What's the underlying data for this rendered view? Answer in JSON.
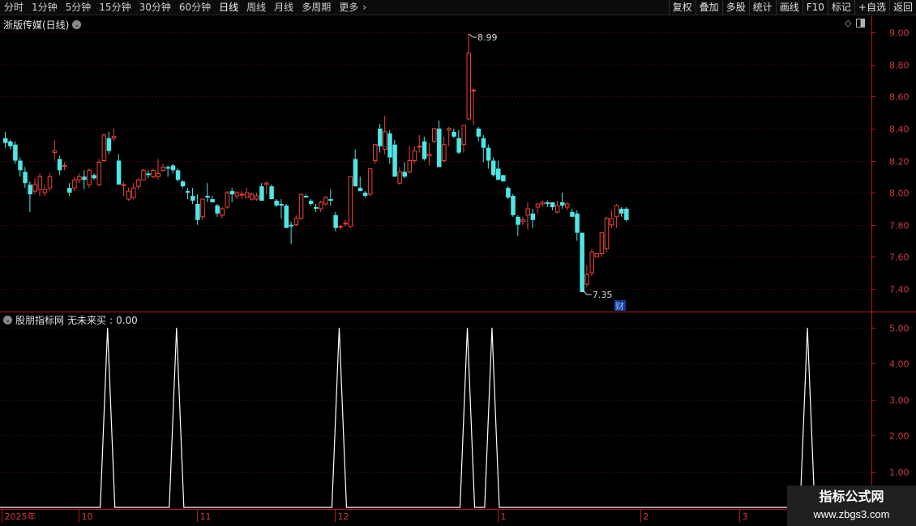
{
  "toolbar": {
    "periods": [
      "分时",
      "1分钟",
      "5分钟",
      "15分钟",
      "30分钟",
      "60分钟",
      "日线",
      "周线",
      "月线",
      "多周期",
      "更多"
    ],
    "active_period": "日线",
    "more_arrow": "›",
    "right_buttons": [
      "复权",
      "叠加",
      "多股",
      "统计",
      "画线",
      "F10",
      "标记",
      "+自选",
      "返回"
    ]
  },
  "price_panel": {
    "title": "浙版传媒(日线)",
    "high_label": "8.99",
    "low_label": "7.35",
    "cai_badge": "财"
  },
  "indicator_panel": {
    "source": "股朋指标网",
    "name": "无未来买",
    "value": "0.00"
  },
  "x_axis": {
    "labels": [
      {
        "text": "2025年",
        "bar": 0
      },
      {
        "text": "10",
        "bar": 16
      },
      {
        "text": "11",
        "bar": 40
      },
      {
        "text": "12",
        "bar": 68
      },
      {
        "text": "1",
        "bar": 101
      },
      {
        "text": "2",
        "bar": 130
      },
      {
        "text": "3",
        "bar": 150
      }
    ]
  },
  "colors": {
    "up": "#f0443a",
    "down": "#4fe6e6",
    "frame": "#b21a1a",
    "axis_text": "#d23c3c",
    "line": "#ffffff"
  },
  "watermark": {
    "line1": "指标公式网",
    "line2": "www.zbgs3.com"
  },
  "chart_data": [
    {
      "type": "candlestick",
      "series_name": "浙版传媒(日线)",
      "ylim": [
        7.3,
        9.05
      ],
      "yticks": [
        7.4,
        7.6,
        7.8,
        8.0,
        8.2,
        8.4,
        8.6,
        8.8,
        9.0
      ],
      "ohlc": [
        [
          8.34,
          8.38,
          8.28,
          8.31
        ],
        [
          8.32,
          8.33,
          8.27,
          8.29
        ],
        [
          8.3,
          8.32,
          8.18,
          8.2
        ],
        [
          8.2,
          8.22,
          8.1,
          8.14
        ],
        [
          8.13,
          8.16,
          8.03,
          8.06
        ],
        [
          8.05,
          8.07,
          7.88,
          7.99
        ],
        [
          8.01,
          8.09,
          7.99,
          8.05
        ],
        [
          8.02,
          8.12,
          7.98,
          8.1
        ],
        [
          8.0,
          8.05,
          7.98,
          8.02
        ],
        [
          8.03,
          8.12,
          8.01,
          8.1
        ],
        [
          8.25,
          8.33,
          8.2,
          8.26
        ],
        [
          8.21,
          8.23,
          8.11,
          8.14
        ],
        [
          8.17,
          8.19,
          8.14,
          8.17
        ],
        [
          8.03,
          8.06,
          7.98,
          8.0
        ],
        [
          8.03,
          8.1,
          8.01,
          8.08
        ],
        [
          8.08,
          8.12,
          8.06,
          8.1
        ],
        [
          8.1,
          8.14,
          8.02,
          8.08
        ],
        [
          8.05,
          8.15,
          8.03,
          8.14
        ],
        [
          8.11,
          8.12,
          8.08,
          8.09
        ],
        [
          8.05,
          8.21,
          8.04,
          8.19
        ],
        [
          8.2,
          8.37,
          8.19,
          8.36
        ],
        [
          8.34,
          8.38,
          8.24,
          8.26
        ],
        [
          8.34,
          8.4,
          8.32,
          8.35
        ],
        [
          8.2,
          8.24,
          8.07,
          8.05
        ],
        [
          8.05,
          8.07,
          7.98,
          8.05
        ],
        [
          7.96,
          8.03,
          7.95,
          8.01
        ],
        [
          7.97,
          8.06,
          7.96,
          8.03
        ],
        [
          8.04,
          8.09,
          8.02,
          8.08
        ],
        [
          8.08,
          8.15,
          8.08,
          8.14
        ],
        [
          8.12,
          8.14,
          8.09,
          8.11
        ],
        [
          8.1,
          8.15,
          8.09,
          8.14
        ],
        [
          8.1,
          8.21,
          8.08,
          8.12
        ],
        [
          8.14,
          8.18,
          8.13,
          8.16
        ],
        [
          8.16,
          8.17,
          8.1,
          8.15
        ],
        [
          8.17,
          8.18,
          8.12,
          8.14
        ],
        [
          8.14,
          8.15,
          8.07,
          8.08
        ],
        [
          8.07,
          8.08,
          8.03,
          8.04
        ],
        [
          8.01,
          8.03,
          7.96,
          8.0
        ],
        [
          7.98,
          8.03,
          7.93,
          7.95
        ],
        [
          7.93,
          7.99,
          7.8,
          7.83
        ],
        [
          7.85,
          7.96,
          7.83,
          7.96
        ],
        [
          7.98,
          8.06,
          7.94,
          7.97
        ],
        [
          7.96,
          7.98,
          7.94,
          7.94
        ],
        [
          7.92,
          7.93,
          7.85,
          7.87
        ],
        [
          7.86,
          7.91,
          7.84,
          7.9
        ],
        [
          7.91,
          8.01,
          7.9,
          8.0
        ],
        [
          8.01,
          8.03,
          7.94,
          7.99
        ],
        [
          7.98,
          8.01,
          7.96,
          8.0
        ],
        [
          7.99,
          8.01,
          7.96,
          7.99
        ],
        [
          7.97,
          8.03,
          7.97,
          8.0
        ],
        [
          7.96,
          8.0,
          7.95,
          7.99
        ],
        [
          7.96,
          8.0,
          7.95,
          7.98
        ],
        [
          8.04,
          8.06,
          7.95,
          7.95
        ],
        [
          8.05,
          8.07,
          7.99,
          8.06
        ],
        [
          8.04,
          8.05,
          7.96,
          7.96
        ],
        [
          7.95,
          7.96,
          7.91,
          7.92
        ],
        [
          7.93,
          7.96,
          7.84,
          7.92
        ],
        [
          7.92,
          7.93,
          7.79,
          7.78
        ],
        [
          7.8,
          7.82,
          7.68,
          7.79
        ],
        [
          7.8,
          7.86,
          7.79,
          7.84
        ],
        [
          7.84,
          7.99,
          7.83,
          7.99
        ],
        [
          7.98,
          7.99,
          7.97,
          7.97
        ],
        [
          7.95,
          7.96,
          7.92,
          7.93
        ],
        [
          7.91,
          7.93,
          7.88,
          7.9
        ],
        [
          7.9,
          7.95,
          7.88,
          7.94
        ],
        [
          7.93,
          7.98,
          7.92,
          7.97
        ],
        [
          7.96,
          8.02,
          7.92,
          7.95
        ],
        [
          7.86,
          7.88,
          7.76,
          7.78
        ],
        [
          7.79,
          7.8,
          7.77,
          7.79
        ],
        [
          7.81,
          7.83,
          7.79,
          7.81
        ],
        [
          7.79,
          8.1,
          7.78,
          8.1
        ],
        [
          8.21,
          8.27,
          8.04,
          8.04
        ],
        [
          8.03,
          8.1,
          8.01,
          8.01
        ],
        [
          8.0,
          8.01,
          7.97,
          7.98
        ],
        [
          7.99,
          8.15,
          7.98,
          8.15
        ],
        [
          8.2,
          8.3,
          8.18,
          8.3
        ],
        [
          8.4,
          8.43,
          8.25,
          8.29
        ],
        [
          8.27,
          8.48,
          8.24,
          8.38
        ],
        [
          8.37,
          8.39,
          8.18,
          8.22
        ],
        [
          8.3,
          8.33,
          8.1,
          8.1
        ],
        [
          8.06,
          8.16,
          8.05,
          8.13
        ],
        [
          8.13,
          8.19,
          8.09,
          8.1
        ],
        [
          8.13,
          8.29,
          8.12,
          8.2
        ],
        [
          8.2,
          8.29,
          8.18,
          8.26
        ],
        [
          8.29,
          8.36,
          8.25,
          8.29
        ],
        [
          8.32,
          8.35,
          8.2,
          8.21
        ],
        [
          8.23,
          8.31,
          8.17,
          8.24
        ],
        [
          8.32,
          8.4,
          8.31,
          8.4
        ],
        [
          8.4,
          8.45,
          8.18,
          8.16
        ],
        [
          8.2,
          8.35,
          8.19,
          8.3
        ],
        [
          8.39,
          8.41,
          8.29,
          8.4
        ],
        [
          8.38,
          8.4,
          8.34,
          8.35
        ],
        [
          8.34,
          8.39,
          8.24,
          8.25
        ],
        [
          8.3,
          8.4,
          8.25,
          8.42
        ],
        [
          8.46,
          8.99,
          8.45,
          8.87
        ],
        [
          8.64,
          8.65,
          8.42,
          8.64
        ],
        [
          8.4,
          8.41,
          8.32,
          8.35
        ],
        [
          8.34,
          8.36,
          8.19,
          8.28
        ],
        [
          8.28,
          8.3,
          8.15,
          8.2
        ],
        [
          8.2,
          8.22,
          8.1,
          8.11
        ],
        [
          8.15,
          8.2,
          8.08,
          8.08
        ],
        [
          8.11,
          8.11,
          8.07,
          8.07
        ],
        [
          8.03,
          8.04,
          7.96,
          7.97
        ],
        [
          7.98,
          7.99,
          7.85,
          7.86
        ],
        [
          7.85,
          7.86,
          7.73,
          7.8
        ],
        [
          7.82,
          7.85,
          7.8,
          7.83
        ],
        [
          7.86,
          7.94,
          7.77,
          7.9
        ],
        [
          7.87,
          7.9,
          7.78,
          7.83
        ],
        [
          7.91,
          7.92,
          7.87,
          7.93
        ],
        [
          7.93,
          7.95,
          7.91,
          7.94
        ],
        [
          7.94,
          7.95,
          7.91,
          7.93
        ],
        [
          7.94,
          7.94,
          7.89,
          7.91
        ],
        [
          7.88,
          7.95,
          7.87,
          7.92
        ],
        [
          7.94,
          8.0,
          7.9,
          7.92
        ],
        [
          7.91,
          7.94,
          7.89,
          7.93
        ],
        [
          7.88,
          7.9,
          7.85,
          7.85
        ],
        [
          7.87,
          7.89,
          7.7,
          7.75
        ],
        [
          7.75,
          7.75,
          7.4,
          7.38
        ],
        [
          7.43,
          7.55,
          7.41,
          7.49
        ],
        [
          7.5,
          7.65,
          7.48,
          7.63
        ],
        [
          7.6,
          7.62,
          7.6,
          7.62
        ],
        [
          7.62,
          7.75,
          7.6,
          7.75
        ],
        [
          7.65,
          7.85,
          7.63,
          7.84
        ],
        [
          7.8,
          7.89,
          7.78,
          7.84
        ],
        [
          7.85,
          7.93,
          7.78,
          7.92
        ],
        [
          7.9,
          7.91,
          7.85,
          7.87
        ],
        [
          7.9,
          7.91,
          7.82,
          7.83
        ]
      ]
    },
    {
      "type": "line",
      "series_name": "无未来买",
      "ylim": [
        0,
        5.25
      ],
      "yticks": [
        1.0,
        2.0,
        3.0,
        4.0,
        5.0
      ],
      "value": 0.0,
      "spikes": [
        {
          "bar": 21,
          "value": 5
        },
        {
          "bar": 35,
          "value": 5
        },
        {
          "bar": 68,
          "value": 5
        },
        {
          "bar": 94,
          "value": 5
        },
        {
          "bar": 99,
          "value": 5
        },
        {
          "bar": 163,
          "value": 5
        }
      ]
    }
  ]
}
